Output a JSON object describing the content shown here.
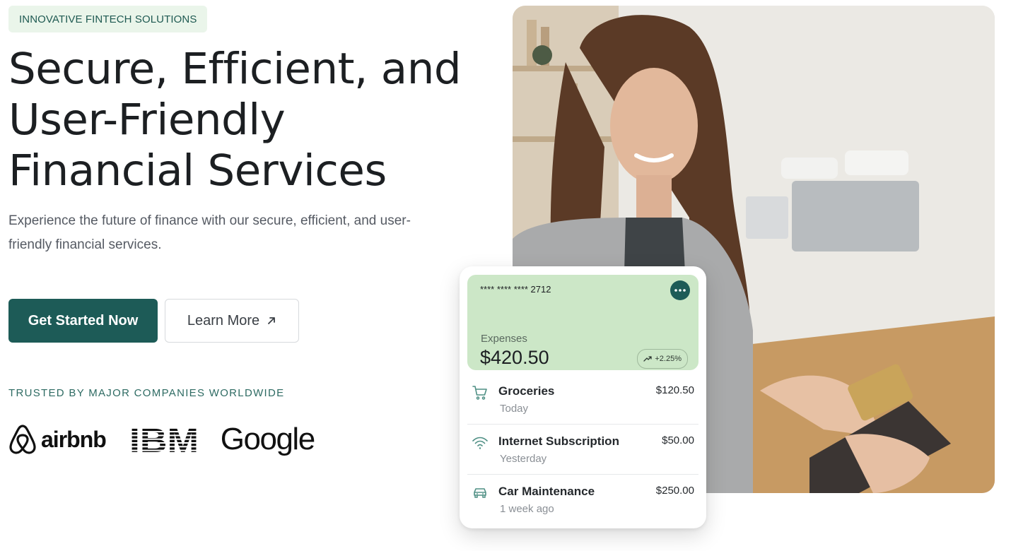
{
  "hero": {
    "badge": "INNOVATIVE FINTECH SOLUTIONS",
    "title_lines": [
      "Secure, Efficient, and",
      "User-Friendly",
      "Financial Services"
    ],
    "subtitle": "Experience the future of finance with our secure, efficient, and user-friendly financial services.",
    "primary_button": "Get Started Now",
    "secondary_button": "Learn More",
    "trusted_label": "TRUSTED BY MAJOR COMPANIES WORLDWIDE",
    "logos": {
      "airbnb": "airbnb",
      "ibm": "IBM",
      "google": "Google"
    }
  },
  "card": {
    "card_number": "**** **** ****  2712",
    "expenses_label": "Expenses",
    "expenses_amount": "$420.50",
    "trend": "+2.25%",
    "transactions": [
      {
        "name": "Groceries",
        "date": "Today",
        "amount": "$120.50",
        "icon": "cart-icon"
      },
      {
        "name": "Internet Subscription",
        "date": "Yesterday",
        "amount": "$50.00",
        "icon": "wifi-icon"
      },
      {
        "name": "Car Maintenance",
        "date": "1 week ago",
        "amount": "$250.00",
        "icon": "car-icon"
      }
    ]
  },
  "colors": {
    "brand": "#1d5b57",
    "badge_bg": "#eaf5ea",
    "card_green": "#cce7c7"
  }
}
